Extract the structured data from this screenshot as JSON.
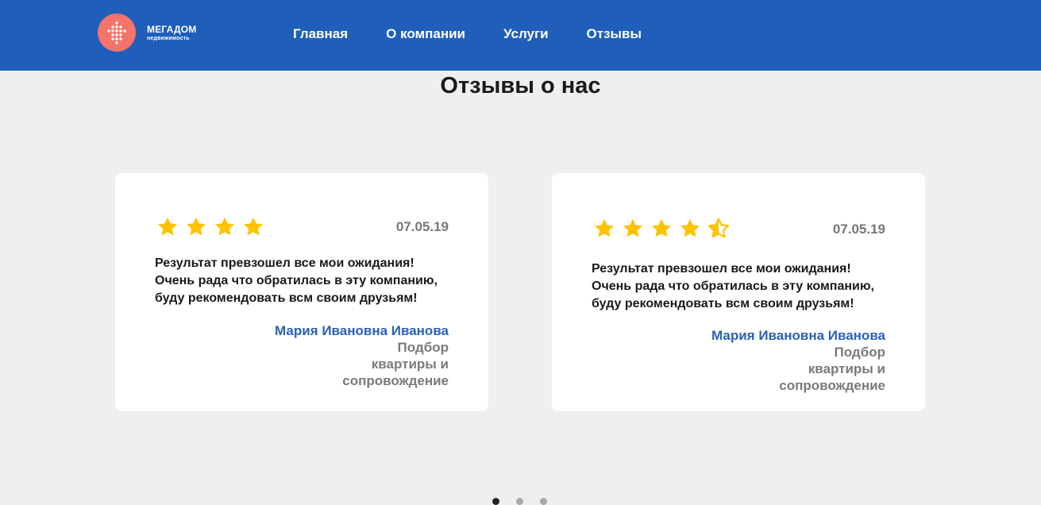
{
  "header": {
    "logo": {
      "name": "МЕГАДОМ",
      "subtitle": "недвижимость"
    },
    "nav": [
      "Главная",
      "О компании",
      "Услуги",
      "Отзывы"
    ]
  },
  "page_title": "Отзывы о нас",
  "reviews": [
    {
      "rating": 4,
      "date": "07.05.19",
      "text": [
        "Результат превзошел все мои ожидания!",
        "Очень рада что обратилась в эту компанию,",
        "буду рекомендовать всм своим друзьям!"
      ],
      "author": "Мария Ивановна Иванова",
      "service": "Подбор квартиры и сопровождение"
    },
    {
      "rating": 4.5,
      "date": "07.05.19",
      "text": [
        "Результат превзошел все мои ожидания!",
        "Очень рада что обратилась в эту компанию,",
        "буду рекомендовать всм своим друзьям!"
      ],
      "author": "Мария Ивановна Иванова",
      "service": "Подбор квартиры и сопровождение"
    }
  ],
  "carousel": {
    "slides": 3,
    "active": 1
  },
  "colors": {
    "header_bg": "#1f5fba",
    "logo_circle": "#f4736a",
    "star": "#ffc300",
    "author": "#2a62b5"
  },
  "icons": [
    "logo-dots-icon",
    "star-icon",
    "half-star-icon",
    "carousel-dot"
  ]
}
